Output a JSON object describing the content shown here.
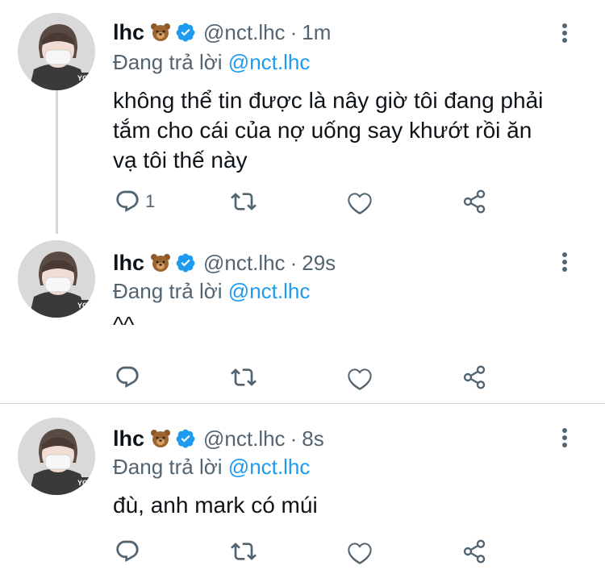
{
  "tweets": [
    {
      "name": "lhc",
      "handle": "@nct.lhc",
      "separator": "·",
      "time": "1m",
      "replying_prefix": "Đang trả lời",
      "replying_to": "@nct.lhc",
      "lines": [
        "không thể tin được là nây giờ tôi đang phải",
        "tắm cho cái của nợ uống say khướt rồi ăn",
        "vạ tôi thế này"
      ],
      "reply_count": "1"
    },
    {
      "name": "lhc",
      "handle": "@nct.lhc",
      "separator": "·",
      "time": "29s",
      "replying_prefix": "Đang trả lời",
      "replying_to": "@nct.lhc",
      "lines": [
        "^^"
      ],
      "reply_count": ""
    },
    {
      "name": "lhc",
      "handle": "@nct.lhc",
      "separator": "·",
      "time": "8s",
      "replying_prefix": "Đang trả lời",
      "replying_to": "@nct.lhc",
      "lines": [
        "đù, anh mark có múi"
      ],
      "reply_count": ""
    }
  ],
  "icons": {
    "reply": "reply-icon",
    "retweet": "retweet-icon",
    "like": "heart-icon",
    "share": "share-icon",
    "more": "more-vertical-icon",
    "verified": "verified-badge-icon",
    "emoji": "bear-emoji-icon"
  },
  "colors": {
    "text": "#0f1419",
    "muted": "#536471",
    "accent": "#1d9bf0",
    "divider": "#cfd9de"
  }
}
